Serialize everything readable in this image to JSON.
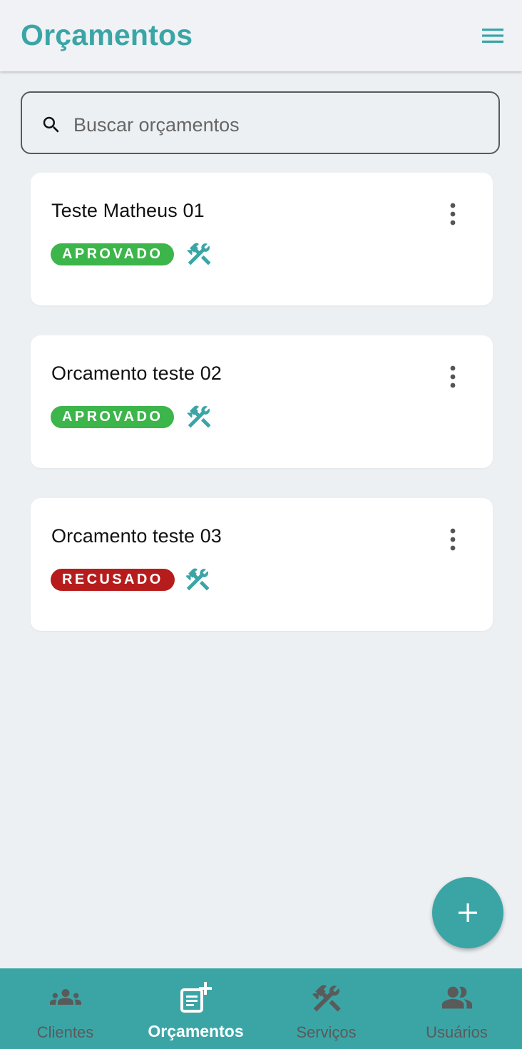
{
  "header": {
    "title": "Orçamentos"
  },
  "search": {
    "placeholder": "Buscar orçamentos",
    "value": ""
  },
  "budgets": [
    {
      "title": "Teste Matheus 01",
      "status": "APROVADO",
      "status_color": "#3cb54a"
    },
    {
      "title": "Orcamento teste 02",
      "status": "APROVADO",
      "status_color": "#3cb54a"
    },
    {
      "title": "Orcamento teste 03",
      "status": "RECUSADO",
      "status_color": "#b71c1c"
    }
  ],
  "icons": {
    "menu": "menu-icon",
    "search": "search-icon",
    "more": "more-vert-icon",
    "services": "hammer-wrench-icon",
    "add": "plus-icon"
  },
  "bottom_nav": {
    "items": [
      {
        "label": "Clientes",
        "icon": "people-icon",
        "active": false
      },
      {
        "label": "Orçamentos",
        "icon": "note-add-icon",
        "active": true
      },
      {
        "label": "Serviços",
        "icon": "hammer-wrench-icon",
        "active": false
      },
      {
        "label": "Usuários",
        "icon": "users-icon",
        "active": false
      }
    ]
  },
  "colors": {
    "primary": "#3ba5a6",
    "background": "#edf0f3",
    "approved": "#3cb54a",
    "refused": "#b71c1c",
    "nav_inactive": "#5a5a5a"
  }
}
